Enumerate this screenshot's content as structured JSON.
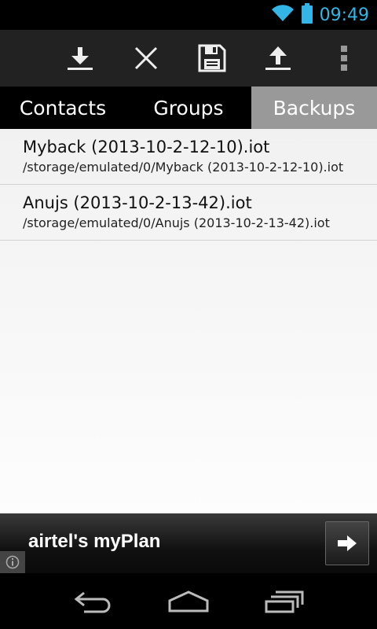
{
  "status_bar": {
    "time": "09:49",
    "icons": [
      "wifi-icon",
      "battery-icon"
    ],
    "accent": "#33b5e5"
  },
  "action_bar": {
    "actions": [
      {
        "icon": "download-icon"
      },
      {
        "icon": "close-icon"
      },
      {
        "icon": "save-icon"
      },
      {
        "icon": "upload-icon"
      },
      {
        "icon": "overflow-menu-icon"
      }
    ]
  },
  "tabs": [
    {
      "label": "Contacts",
      "active": false
    },
    {
      "label": "Groups",
      "active": false
    },
    {
      "label": "Backups",
      "active": true
    }
  ],
  "backups": [
    {
      "title": "Myback (2013-10-2-12-10).iot",
      "path": "/storage/emulated/0/Myback (2013-10-2-12-10).iot"
    },
    {
      "title": "Anujs (2013-10-2-13-42).iot",
      "path": "/storage/emulated/0/Anujs (2013-10-2-13-42).iot"
    }
  ],
  "ad": {
    "text": "airtel's myPlan",
    "button_icon": "arrow-right-icon",
    "info_icon": "info-icon"
  },
  "nav_bar": {
    "buttons": [
      "back-icon",
      "home-icon",
      "recent-apps-icon"
    ]
  }
}
